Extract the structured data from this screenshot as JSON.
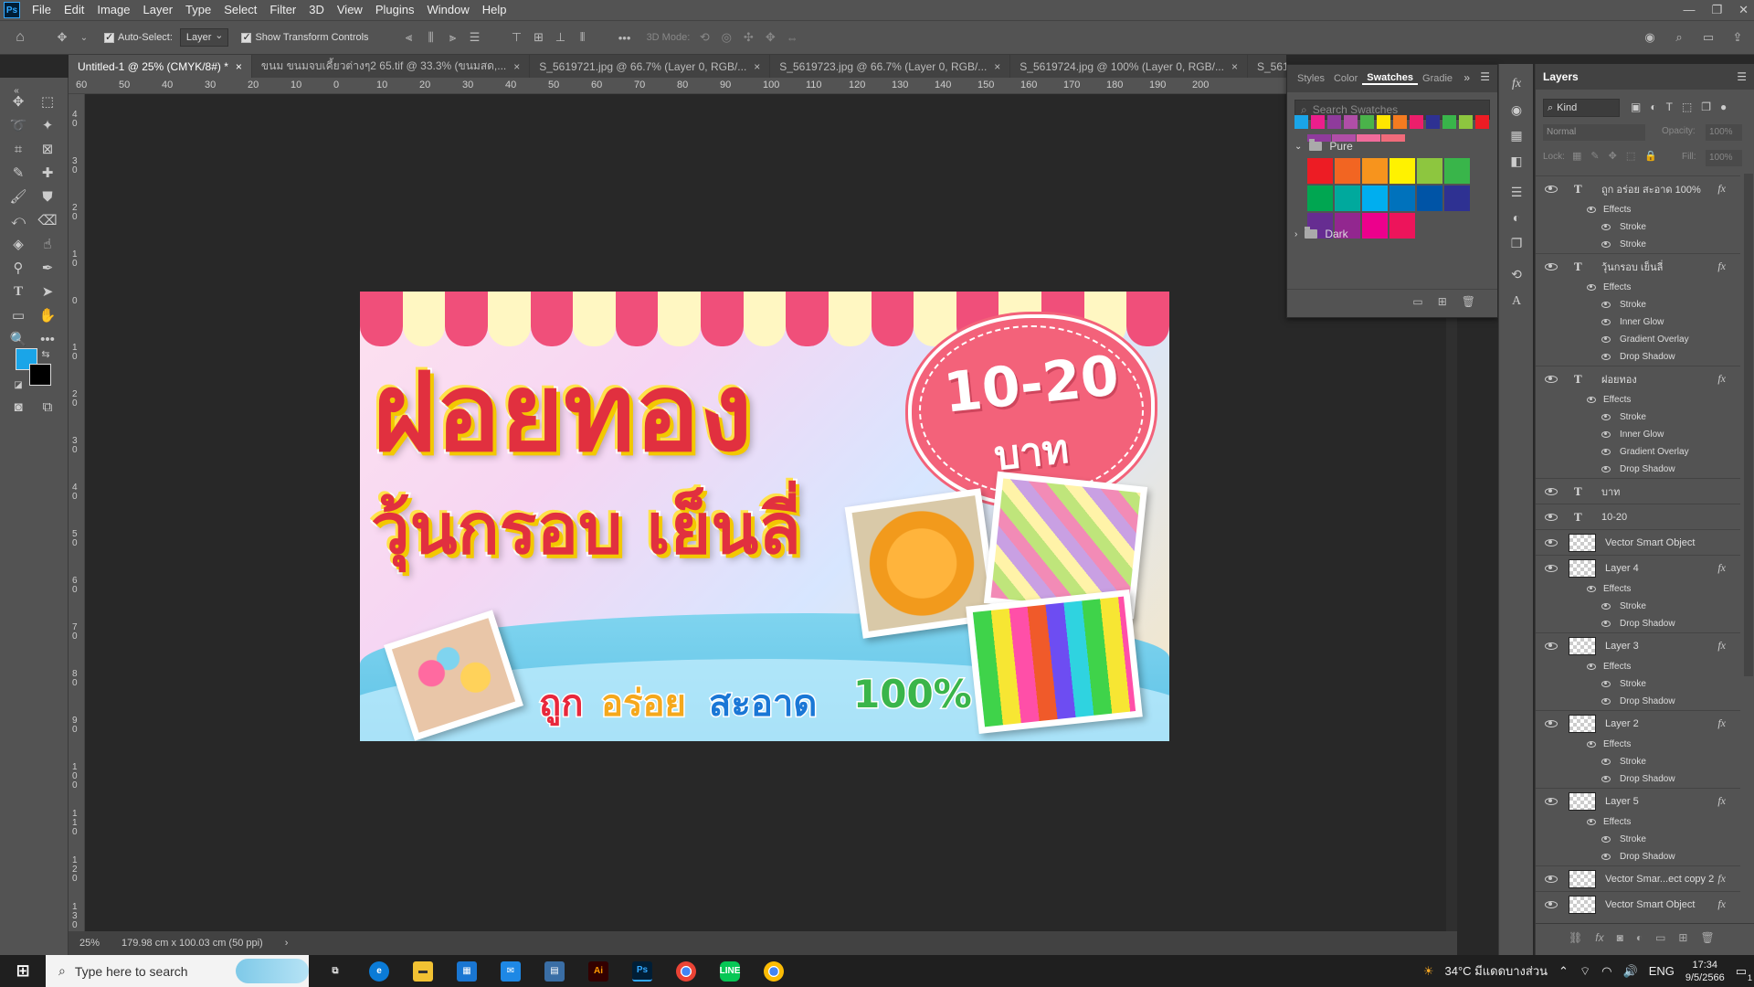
{
  "app": {
    "logo": "Ps"
  },
  "menu": [
    "File",
    "Edit",
    "Image",
    "Layer",
    "Type",
    "Select",
    "Filter",
    "3D",
    "View",
    "Plugins",
    "Window",
    "Help"
  ],
  "options": {
    "auto_select_label": "Auto-Select:",
    "auto_select_value": "Layer",
    "transform_label": "Show Transform Controls",
    "mode_3d": "3D Mode:"
  },
  "tabs": [
    {
      "label": "Untitled-1 @ 25% (CMYK/8#) *",
      "active": true
    },
    {
      "label": "ขนม ขนมจบเคี้ยวต่างๆ2 65.tif @ 33.3% (ขนมสด,..."
    },
    {
      "label": "S_5619721.jpg @ 66.7% (Layer 0, RGB/..."
    },
    {
      "label": "S_5619723.jpg @ 66.7% (Layer 0, RGB/..."
    },
    {
      "label": "S_5619724.jpg @ 100% (Layer 0, RGB/..."
    },
    {
      "label": "S_5619725.jp..."
    }
  ],
  "ruler_top": [
    "60",
    "50",
    "40",
    "30",
    "20",
    "10",
    "0",
    "10",
    "20",
    "30",
    "40",
    "50",
    "60",
    "70",
    "80",
    "90",
    "100",
    "110",
    "120",
    "130",
    "140",
    "150",
    "160",
    "170",
    "180",
    "190",
    "200"
  ],
  "ruler_left": [
    "4 0",
    "3 0",
    "2 0",
    "1 0",
    "0",
    "1 0",
    "2 0",
    "3 0",
    "4 0",
    "5 0",
    "6 0",
    "7 0",
    "8 0",
    "9 0",
    "1 0 0",
    "1 1 0",
    "1 2 0",
    "1 3 0",
    "1 4 0"
  ],
  "status": {
    "zoom": "25%",
    "size": "179.98 cm x 100.03 cm (50 ppi)"
  },
  "colors": {
    "foreground": "#1aa5e8",
    "background": "#000000"
  },
  "swatches_panel": {
    "tabs": [
      "Styles",
      "Color",
      "Swatches",
      "Gradie"
    ],
    "active_tab": "Swatches",
    "search_placeholder": "Search Swatches",
    "recent": [
      "#1aa5e8",
      "#ec1e8c",
      "#8f3b9c",
      "#b04ea7",
      "#4ab34a",
      "#ffe600",
      "#f47b20",
      "#ec1e6b",
      "#2e3192",
      "#39b54a",
      "#8dc63f",
      "#ed1c24"
    ],
    "recent_row2": [
      "#8f3b9c",
      "#b04ea7",
      "#f06b9b",
      "#f06b7a"
    ],
    "group_pure": "Pure",
    "pure": [
      "#ed1c24",
      "#f26522",
      "#f7941d",
      "#fff200",
      "#8dc63f",
      "#39b54a",
      "#00a651",
      "#00a99d",
      "#00aeef",
      "#0072bc",
      "#0054a6",
      "#2e3192",
      "#662d91",
      "#92278f",
      "#ec008c",
      "#ed145b"
    ],
    "group_dark": "Dark"
  },
  "layers_panel": {
    "title": "Layers",
    "filter": "Kind",
    "blend": "Normal",
    "opacity_label": "Opacity:",
    "opacity": "100%",
    "lock_label": "Lock:",
    "fill_label": "Fill:",
    "fill": "100%",
    "rows": [
      {
        "kind": "text",
        "name": "ถูก อร่อย สะอาด 100%",
        "fx": true
      },
      {
        "kind": "effects",
        "name": "Effects"
      },
      {
        "kind": "effect",
        "name": "Stroke"
      },
      {
        "kind": "effect",
        "name": "Stroke"
      },
      {
        "kind": "text",
        "name": "วุ้นกรอบ เย็นลี่",
        "fx": true
      },
      {
        "kind": "effects",
        "name": "Effects"
      },
      {
        "kind": "effect",
        "name": "Stroke"
      },
      {
        "kind": "effect",
        "name": "Inner Glow"
      },
      {
        "kind": "effect",
        "name": "Gradient Overlay"
      },
      {
        "kind": "effect",
        "name": "Drop Shadow"
      },
      {
        "kind": "text",
        "name": "ฝอยทอง",
        "fx": true
      },
      {
        "kind": "effects",
        "name": "Effects"
      },
      {
        "kind": "effect",
        "name": "Stroke"
      },
      {
        "kind": "effect",
        "name": "Inner Glow"
      },
      {
        "kind": "effect",
        "name": "Gradient Overlay"
      },
      {
        "kind": "effect",
        "name": "Drop Shadow"
      },
      {
        "kind": "text",
        "name": "บาท",
        "fx": false
      },
      {
        "kind": "text",
        "name": "10-20",
        "fx": false
      },
      {
        "kind": "smart",
        "name": "Vector Smart Object",
        "fx": false
      },
      {
        "kind": "layer",
        "name": "Layer 4",
        "fx": true
      },
      {
        "kind": "effects",
        "name": "Effects"
      },
      {
        "kind": "effect",
        "name": "Stroke"
      },
      {
        "kind": "effect",
        "name": "Drop Shadow"
      },
      {
        "kind": "layer",
        "name": "Layer 3",
        "fx": true
      },
      {
        "kind": "effects",
        "name": "Effects"
      },
      {
        "kind": "effect",
        "name": "Stroke"
      },
      {
        "kind": "effect",
        "name": "Drop Shadow"
      },
      {
        "kind": "layer",
        "name": "Layer 2",
        "fx": true
      },
      {
        "kind": "effects",
        "name": "Effects"
      },
      {
        "kind": "effect",
        "name": "Stroke"
      },
      {
        "kind": "effect",
        "name": "Drop Shadow"
      },
      {
        "kind": "layer",
        "name": "Layer 5",
        "fx": true
      },
      {
        "kind": "effects",
        "name": "Effects"
      },
      {
        "kind": "effect",
        "name": "Stroke"
      },
      {
        "kind": "effect",
        "name": "Drop Shadow"
      },
      {
        "kind": "layer",
        "name": "Vector Smar...ect copy 2",
        "fx": true
      },
      {
        "kind": "layer",
        "name": "Vector Smart Object",
        "fx": true
      }
    ]
  },
  "artwork": {
    "title1": "ฝอยทอง",
    "title2": "วุ้นกรอบ เย็นลี่",
    "price": "10-20",
    "price_unit": "บาท",
    "slogan_1": "ถูก",
    "slogan_2": "อร่อย",
    "slogan_3": "สะอาด",
    "slogan_4": "100%"
  },
  "taskbar": {
    "search_placeholder": "Type here to search",
    "weather": "34°C มีแดดบางส่วน",
    "lang": "ENG",
    "time": "17:34",
    "date": "9/5/2566",
    "notif_count": "1"
  }
}
